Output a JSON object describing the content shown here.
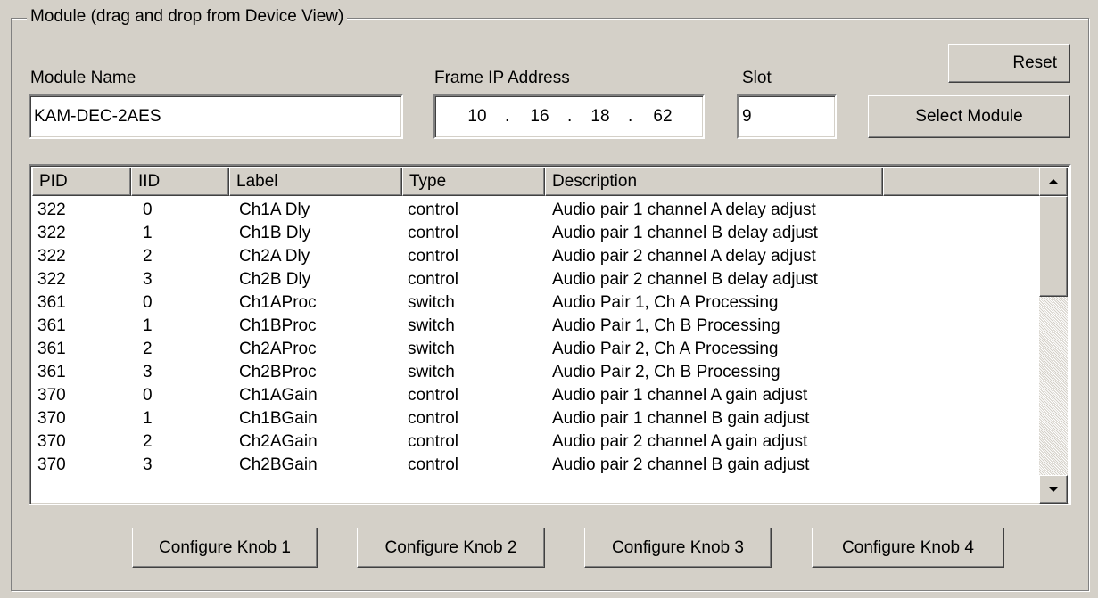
{
  "group": {
    "title": "Module (drag and drop from Device View)"
  },
  "module_name": {
    "label": "Module Name",
    "value": "KAM-DEC-2AES"
  },
  "frame_ip": {
    "label": "Frame IP Address",
    "octets": [
      "10",
      "16",
      "18",
      "62"
    ]
  },
  "slot": {
    "label": "Slot",
    "value": "9"
  },
  "buttons": {
    "reset": "Reset",
    "select_module": "Select Module"
  },
  "table": {
    "columns": [
      "PID",
      "IID",
      "Label",
      "Type",
      "Description",
      ""
    ],
    "rows": [
      {
        "pid": "322",
        "iid": "0",
        "label": "Ch1A Dly",
        "type": "control",
        "description": "Audio pair 1 channel A delay adjust"
      },
      {
        "pid": "322",
        "iid": "1",
        "label": "Ch1B Dly",
        "type": "control",
        "description": "Audio pair 1 channel B delay adjust"
      },
      {
        "pid": "322",
        "iid": "2",
        "label": "Ch2A Dly",
        "type": "control",
        "description": "Audio pair 2 channel A delay adjust"
      },
      {
        "pid": "322",
        "iid": "3",
        "label": "Ch2B Dly",
        "type": "control",
        "description": "Audio pair 2 channel B delay adjust"
      },
      {
        "pid": "361",
        "iid": "0",
        "label": "Ch1AProc",
        "type": "switch",
        "description": "Audio Pair 1, Ch A Processing"
      },
      {
        "pid": "361",
        "iid": "1",
        "label": "Ch1BProc",
        "type": "switch",
        "description": "Audio Pair 1, Ch B Processing"
      },
      {
        "pid": "361",
        "iid": "2",
        "label": "Ch2AProc",
        "type": "switch",
        "description": "Audio Pair 2, Ch A Processing"
      },
      {
        "pid": "361",
        "iid": "3",
        "label": "Ch2BProc",
        "type": "switch",
        "description": "Audio Pair 2, Ch B Processing"
      },
      {
        "pid": "370",
        "iid": "0",
        "label": "Ch1AGain",
        "type": "control",
        "description": "Audio pair 1 channel A gain adjust"
      },
      {
        "pid": "370",
        "iid": "1",
        "label": "Ch1BGain",
        "type": "control",
        "description": "Audio pair 1 channel B gain adjust"
      },
      {
        "pid": "370",
        "iid": "2",
        "label": "Ch2AGain",
        "type": "control",
        "description": "Audio pair 2 channel A gain adjust"
      },
      {
        "pid": "370",
        "iid": "3",
        "label": "Ch2BGain",
        "type": "control",
        "description": "Audio pair 2 channel B gain adjust"
      }
    ]
  },
  "scrollbar": {
    "icons": [
      "scroll-up-arrow-icon",
      "scroll-down-arrow-icon"
    ]
  },
  "knob_buttons": [
    "Configure Knob 1",
    "Configure Knob 2",
    "Configure Knob 3",
    "Configure Knob 4"
  ],
  "colors": {
    "face": "#d4d0c8",
    "shadow": "#808080",
    "highlight": "#ffffff",
    "window": "#ffffff"
  }
}
